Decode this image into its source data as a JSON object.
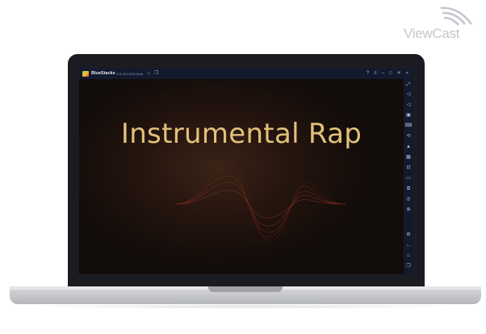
{
  "watermark": {
    "text": "ViewCast"
  },
  "window": {
    "app_name": "BlueStacks",
    "version": "5.8.110.1028 Beta",
    "titlebar_icons": [
      "home-icon",
      "multi-instance-icon"
    ],
    "controls": [
      "help-icon",
      "menu-icon",
      "minimize-icon",
      "maximize-icon",
      "close-icon",
      "collapse-sidebar-icon"
    ]
  },
  "video": {
    "title": "Instrumental Rap"
  },
  "sidebar": {
    "tools": [
      "fullscreen-icon",
      "volume-up-icon",
      "volume-down-icon",
      "media-icon",
      "keyboard-icon",
      "rotate-icon",
      "install-apk-icon",
      "screenshot-icon",
      "record-icon",
      "folder-icon",
      "multi-instance-icon",
      "macro-icon",
      "eco-mode-icon",
      "settings-icon",
      "back-icon",
      "home-icon",
      "recent-apps-icon"
    ]
  },
  "colors": {
    "accent_gold": "#e2c17a",
    "chrome": "#141a2e"
  }
}
